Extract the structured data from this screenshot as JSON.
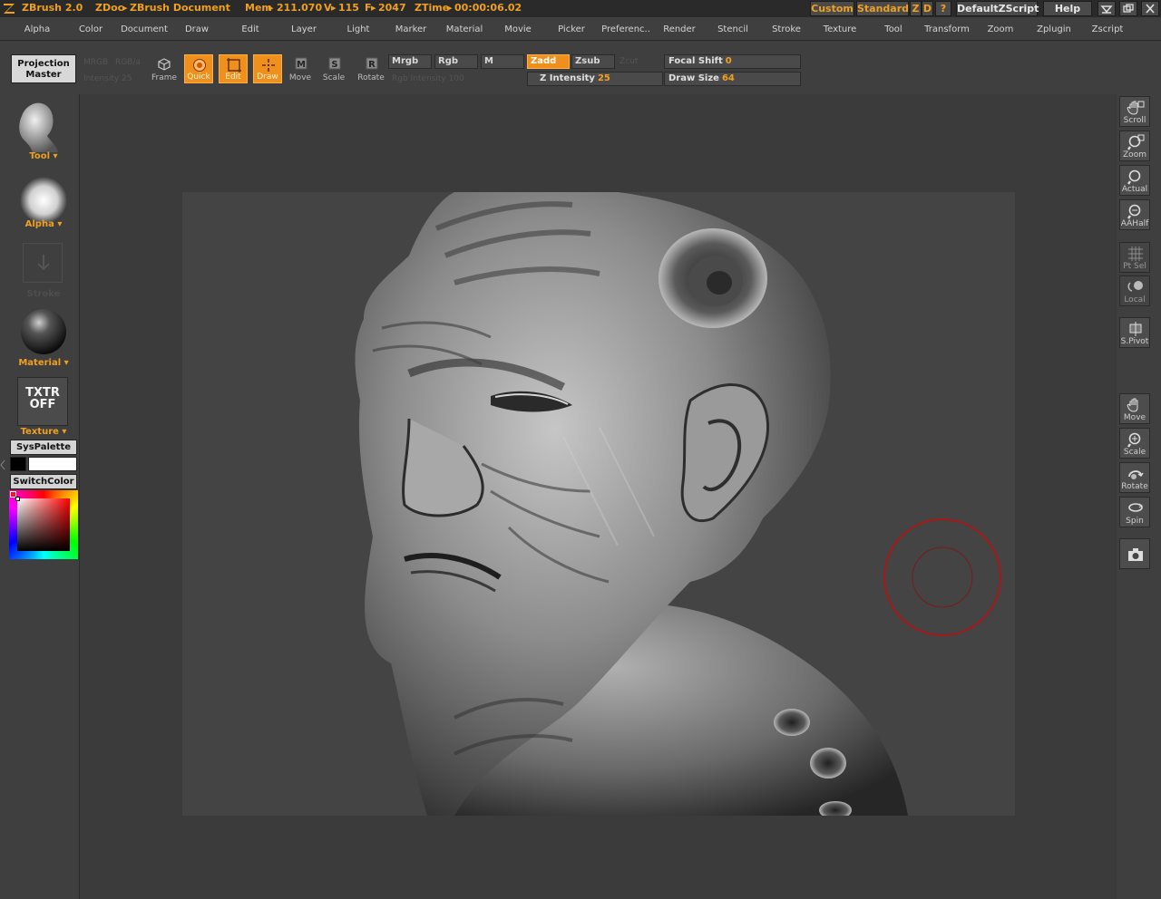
{
  "titlebar": {
    "app": "ZBrush 2.0",
    "doc_prefix": "ZDoc",
    "doc_name": "ZBrush Document",
    "mem_label": "Mem",
    "mem_value": "211.070",
    "v_label": "V",
    "v_value": "115",
    "f_label": "F",
    "f_value": "2047",
    "ztime_label": "ZTime",
    "ztime_value": "00:00:06.02",
    "custom": "Custom",
    "standard": "Standard",
    "z": "Z",
    "d": "D",
    "question": "?",
    "script": "DefaultZScript",
    "help": "Help"
  },
  "menu": [
    "Alpha",
    "Color",
    "Document",
    "Draw",
    "Edit",
    "Layer",
    "Light",
    "Marker",
    "Material",
    "Movie",
    "Picker",
    "Preferenc..",
    "Render",
    "Stencil",
    "Stroke",
    "Texture",
    "Tool",
    "Transform",
    "Zoom",
    "Zplugin",
    "Zscript"
  ],
  "toolbar": {
    "projection_line1": "Projection",
    "projection_line2": "Master",
    "ghost_mrgb": "MRGB",
    "ghost_rgb": "RGB/a",
    "ghost_intensity": "Intensity 25",
    "ghost_rgbint": "Rgb Intensity 100",
    "ghost_zcut": "Zcut",
    "frame": "Frame",
    "quick": "Quick",
    "edit": "Edit",
    "draw": "Draw",
    "move": "Move",
    "scale": "Scale",
    "rotate": "Rotate",
    "mrgb": "Mrgb",
    "rgb": "Rgb",
    "m": "M",
    "zadd": "Zadd",
    "zsub": "Zsub",
    "z_intensity_label": "Z Intensity",
    "z_intensity_value": "25",
    "focal_label": "Focal Shift",
    "focal_value": "0",
    "draw_size_label": "Draw Size",
    "draw_size_value": "64"
  },
  "leftpanel": {
    "tool": "Tool",
    "alpha": "Alpha",
    "stroke": "Stroke",
    "material": "Material",
    "txtr_line1": "TXTR",
    "txtr_line2": "OFF",
    "texture": "Texture",
    "syspalette": "SysPalette",
    "switchcolor": "SwitchColor"
  },
  "rightshelf": [
    {
      "label": "Scroll",
      "icon": "scroll-hand-icon"
    },
    {
      "label": "Zoom",
      "icon": "zoom-magnifier-icon"
    },
    {
      "label": "Actual",
      "icon": "actual-size-icon"
    },
    {
      "label": "AAHalf",
      "icon": "aahalf-icon"
    },
    {
      "label": "Pt Sel",
      "icon": "point-select-icon"
    },
    {
      "label": "Local",
      "icon": "local-icon"
    },
    {
      "label": "S.Pivot",
      "icon": "pivot-icon"
    },
    {
      "label": "Move",
      "icon": "move-hand-icon"
    },
    {
      "label": "Scale",
      "icon": "scale-icon"
    },
    {
      "label": "Rotate",
      "icon": "rotate-icon"
    },
    {
      "label": "Spin",
      "icon": "spin-icon"
    }
  ],
  "colors": {
    "accent": "#f0a020",
    "active_button": "#f0901c",
    "background": "#3a3a3a",
    "brush_cursor": "#a81818"
  }
}
